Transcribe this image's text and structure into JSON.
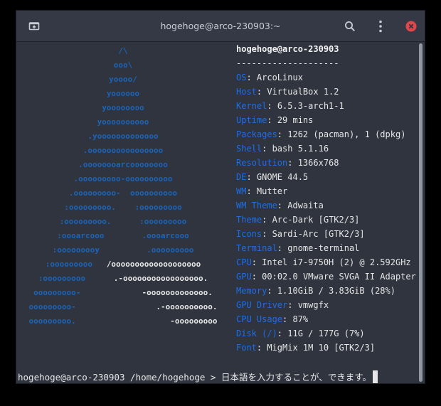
{
  "window": {
    "title": "hogehoge@arco-230903:~"
  },
  "headerbar": {
    "icons": [
      "new-tab-icon",
      "search-icon",
      "menu-dots-icon",
      "close-icon"
    ],
    "close_color": "#e0474c"
  },
  "logo": {
    "lines": [
      {
        "blue": "/\\",
        "white": ""
      },
      {
        "blue": "ooo\\",
        "white": ""
      },
      {
        "blue": "yoooo/",
        "white": ""
      },
      {
        "blue": "yoooooo",
        "white": ""
      },
      {
        "blue": "yoooooooo",
        "white": ""
      },
      {
        "blue": "yoooooooooo",
        "white": ""
      },
      {
        "blue": ".yooooooooooooo",
        "white": ""
      },
      {
        "blue": ".oooooooooooooooo",
        "white": ""
      },
      {
        "blue": ".oooooooarcoooooooo",
        "white": ""
      },
      {
        "blue": ".ooooooooo-oooooooooo",
        "white": ""
      },
      {
        "blue": ".ooooooooo-  oooooooooo",
        "white": ""
      },
      {
        "blue": ":ooooooooo.    :ooooooooo",
        "white": ""
      },
      {
        "blue": ":ooooooooo.      :ooooooooo",
        "white": ""
      },
      {
        "blue": ":oooarcooo        .oooarcooo",
        "white": ""
      },
      {
        "blue": ":ooooooooy          .ooooooooo",
        "white": ""
      },
      {
        "blue": ":ooooooooo   ",
        "white": "/ooooooooooooooooooo"
      },
      {
        "blue": ":ooooooooo      ",
        "white": ".-ooooooooooooooooo."
      },
      {
        "blue": "ooooooooo-             ",
        "white": "-ooooooooooooo."
      },
      {
        "blue": "ooooooooo-                 ",
        "white": ".-oooooooooo."
      },
      {
        "blue": "ooooooooo.                    ",
        "white": "-ooooooooo"
      }
    ]
  },
  "info": {
    "title": "hogehoge@arco-230903",
    "separator": "--------------------",
    "rows": [
      {
        "key": "OS",
        "value": "ArcoLinux"
      },
      {
        "key": "Host",
        "value": "VirtualBox 1.2"
      },
      {
        "key": "Kernel",
        "value": "6.5.3-arch1-1"
      },
      {
        "key": "Uptime",
        "value": "29 mins"
      },
      {
        "key": "Packages",
        "value": "1262 (pacman), 1 (dpkg)"
      },
      {
        "key": "Shell",
        "value": "bash 5.1.16"
      },
      {
        "key": "Resolution",
        "value": "1366x768"
      },
      {
        "key": "DE",
        "value": "GNOME 44.5"
      },
      {
        "key": "WM",
        "value": "Mutter"
      },
      {
        "key": "WM Theme",
        "value": "Adwaita"
      },
      {
        "key": "Theme",
        "value": "Arc-Dark [GTK2/3]"
      },
      {
        "key": "Icons",
        "value": "Sardi-Arc [GTK2/3]"
      },
      {
        "key": "Terminal",
        "value": "gnome-terminal"
      },
      {
        "key": "CPU",
        "value": "Intel i7-9750H (2) @ 2.592GHz"
      },
      {
        "key": "GPU",
        "value": "00:02.0 VMware SVGA II Adapter"
      },
      {
        "key": "Memory",
        "value": "1.10GiB / 3.83GiB (28%)"
      },
      {
        "key": "GPU Driver",
        "value": "vmwgfx"
      },
      {
        "key": "CPU Usage",
        "value": "87%"
      },
      {
        "key": "Disk (/)",
        "value": "11G / 177G (7%)"
      },
      {
        "key": "Font",
        "value": "MigMix 1M 10 [GTK2/3]"
      }
    ]
  },
  "prompt": {
    "text": "hogehoge@arco-230903 /home/hogehoge > 日本語を入力することが、できます。"
  },
  "colors": {
    "accent": "#1d6ee6",
    "logo_blue": "#1c64b8",
    "background": "#2f343f"
  }
}
